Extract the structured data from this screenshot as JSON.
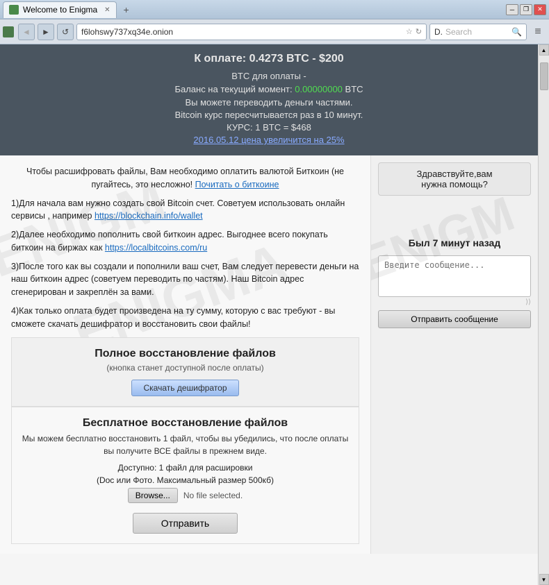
{
  "titlebar": {
    "tab_label": "Welcome to Enigma",
    "new_tab_icon": "+",
    "minimize": "─",
    "restore": "❐",
    "close": "✕"
  },
  "navbar": {
    "back_btn": "◄",
    "forward_btn": "►",
    "reload_btn": "↺",
    "address": "f6lohswy737xq34e.onion",
    "search_placeholder": "Search",
    "menu_icon": "≡",
    "d_icon": "D."
  },
  "header": {
    "payment_title": "К оплате: 0.4273 BTC - $200",
    "btc_label": "BТС для оплаты -",
    "balance_label": "Баланс на текущий момент:",
    "balance_value": "0.00000000",
    "balance_currency": "BTC",
    "partial_note": "Вы можете переводить деньги частями.",
    "rate_note": "Bitcoin курс пересчитывается раз в 10 минут.",
    "rate_current": "КУРС: 1 BTC = $468",
    "price_link": "2016.05.12 цена увеличится на 25%"
  },
  "left_panel": {
    "intro_text": "Чтобы расшифровать файлы, Вам необходимо оплатить валютой Биткоин (не пугайтесь, это несложно!",
    "read_about_link": "Почитать о биткоине",
    "step1": "1)Для начала вам нужно создать свой Bitcoin счет. Советуем использовать онлайн сервисы , например",
    "step1_link": "https://blockchain.info/wallet",
    "step2": "2)Далее необходимо пополнить свой биткоин адрес. Выгоднее всего покупать биткоин на биржах как",
    "step2_link": "https://localbitcoins.com/ru",
    "step3": "3)После того как вы создали и пополнили ваш счет, Вам следует перевести деньги на наш биткоин адрес (советуем переводить по частям). Наш Bitcoin адрес сгенерирован и закреплён за вами.",
    "step4": "4)Как только оплата будет произведена на ту сумму, которую с вас требуют - вы сможете скачать дешифратор и восстановить свои файлы!"
  },
  "full_restore": {
    "title": "Полное восстановление файлов",
    "subtitle": "(кнопка станет доступной после оплаты)",
    "button": "Скачать дешифратор"
  },
  "free_restore": {
    "title": "Бесплатное восстановление файлов",
    "description": "Мы можем бесплатно восстановить 1 файл, чтобы вы убедились, что после оплаты вы получите ВСЕ файлы в прежнем виде.",
    "available": "Доступно: 1 файл для расшировки",
    "file_type": "(Doc или Фото. Максимальный размер 500кб)",
    "browse_btn": "Browse...",
    "no_file": "No file selected.",
    "submit_btn": "Отправить"
  },
  "chat": {
    "greeting": "Здравствуйте,вам\n нужна помощь?",
    "time_ago": "Был 7 минут назад",
    "input_placeholder": "Введите сообщение...",
    "send_btn": "Отправить сообщение"
  },
  "watermarks": {
    "text1": "ENIGM",
    "text2": "ENIGMA"
  }
}
